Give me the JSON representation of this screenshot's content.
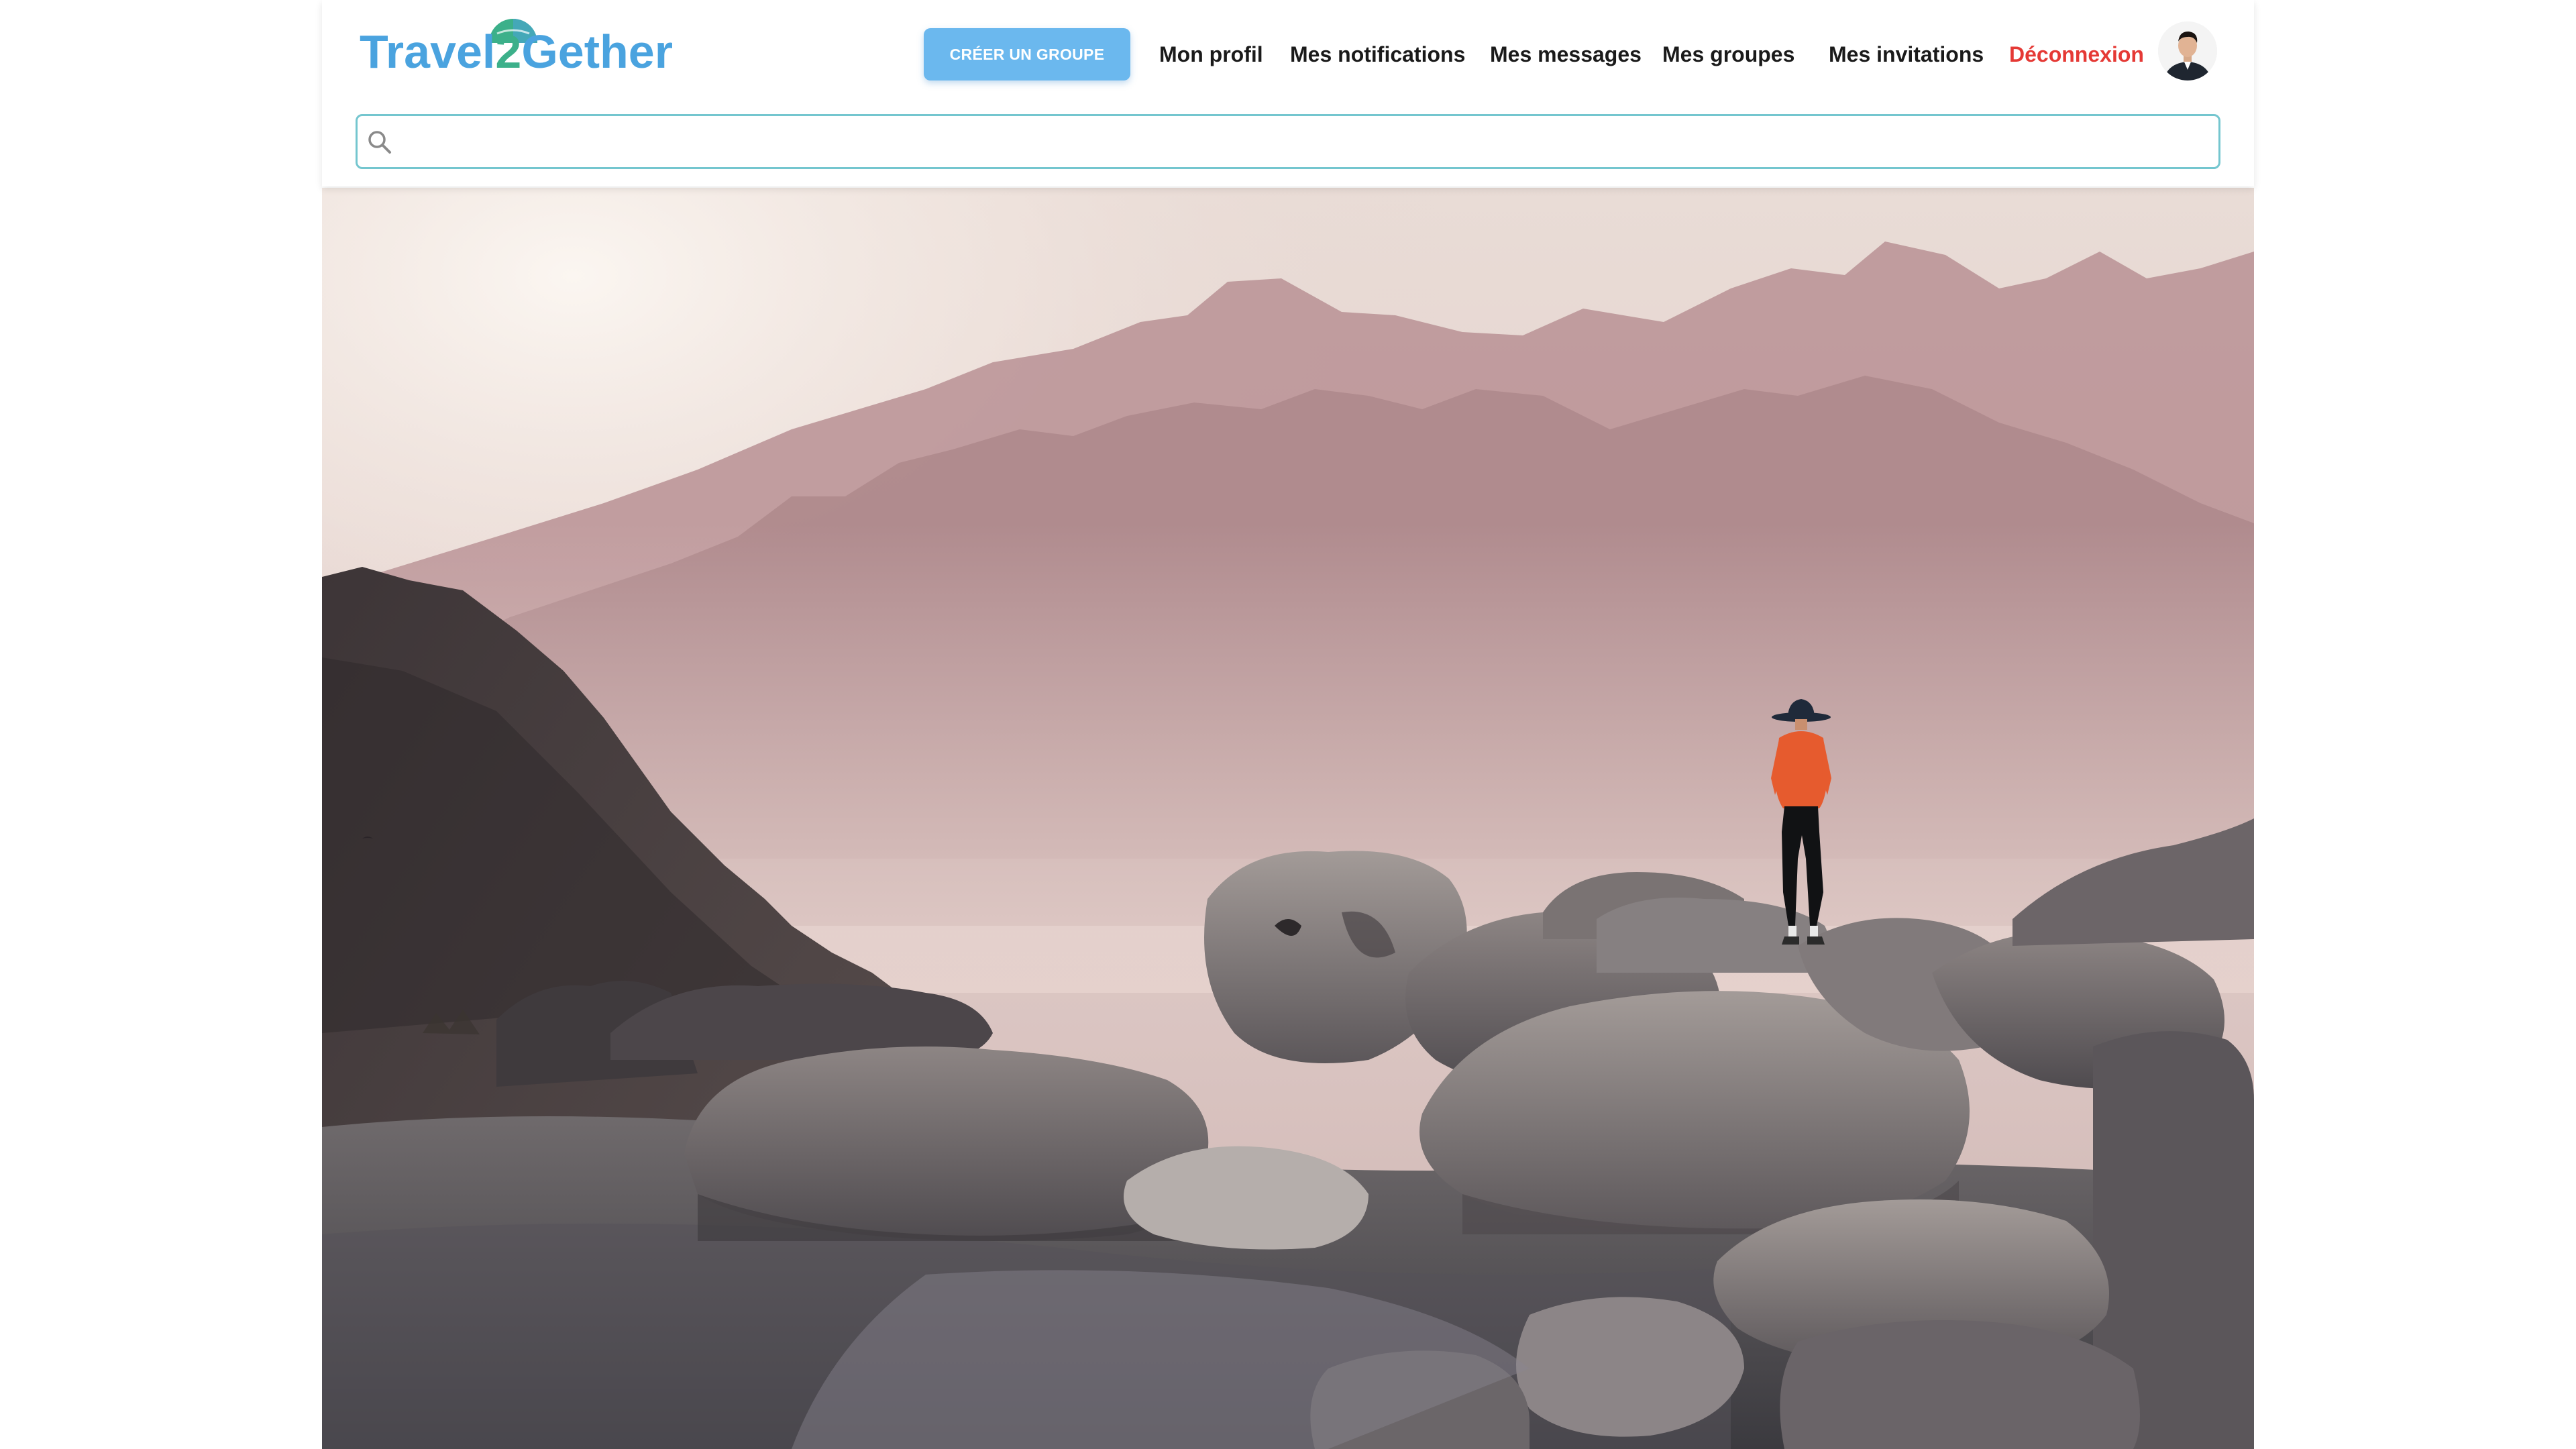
{
  "app": {
    "logo": {
      "part1": "Travel",
      "part2": "2",
      "part3": "Gether"
    }
  },
  "header": {
    "create_group_label": "CRÉER UN GROUPE",
    "nav": {
      "profile": "Mon profil",
      "notifications": "Mes notifications",
      "messages": "Mes messages",
      "groups": "Mes groupes",
      "invitations": "Mes invitations",
      "logout": "Déconnexion"
    },
    "search": {
      "placeholder": "",
      "value": ""
    }
  },
  "colors": {
    "accent_button": "#6bb8ee",
    "logo_blue": "#4aa3df",
    "logo_green": "#3cb08a",
    "logout_red": "#e53935",
    "search_border": "#74c6cf"
  },
  "icons": {
    "search": "search-icon",
    "avatar": "user-avatar"
  }
}
